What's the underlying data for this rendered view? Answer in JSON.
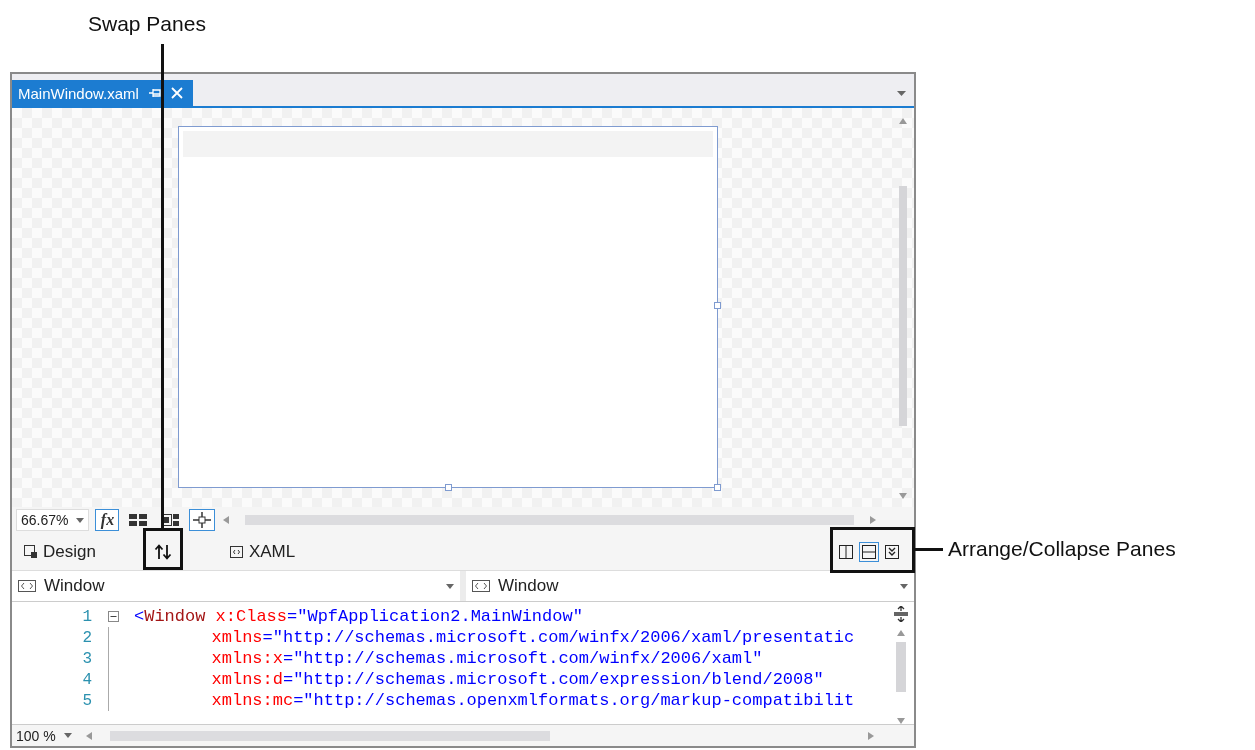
{
  "callouts": [
    {
      "label": "Swap Panes"
    },
    {
      "label": "Arrange/Collapse Panes"
    }
  ],
  "document_tab": {
    "title": "MainWindow.xaml"
  },
  "designer": {
    "zoom": "66.67%",
    "tools": [
      {
        "kind": "fx",
        "label": "fx",
        "on": true
      },
      {
        "kind": "grid",
        "on": false
      },
      {
        "kind": "snap-grid",
        "on": false
      },
      {
        "kind": "snap-points",
        "on": true
      }
    ]
  },
  "view_tabs": [
    {
      "kind": "design",
      "label": "Design"
    },
    {
      "kind": "swap"
    },
    {
      "kind": "xaml",
      "label": "XAML"
    }
  ],
  "pane_buttons": [
    {
      "kind": "vertical",
      "selected": false
    },
    {
      "kind": "horizontal",
      "selected": true
    },
    {
      "kind": "collapse",
      "selected": false
    }
  ],
  "element_selectors": [
    {
      "label": "Window"
    },
    {
      "label": "Window"
    }
  ],
  "code_lines": [
    {
      "number": "1",
      "fold_toggle": true,
      "indented": false,
      "segments": [
        {
          "kind": "punct",
          "text": "<"
        },
        {
          "kind": "element",
          "text": "Window"
        },
        {
          "kind": "attr",
          "text": "x:Class"
        },
        {
          "kind": "punct",
          "text": "="
        },
        {
          "kind": "value",
          "text": "\"WpfApplication2.MainWindow\""
        }
      ]
    },
    {
      "number": "2",
      "fold_toggle": false,
      "indented": true,
      "segments": [
        {
          "kind": "attr",
          "text": "xmlns"
        },
        {
          "kind": "punct",
          "text": "="
        },
        {
          "kind": "value",
          "text": "\"http://schemas.microsoft.com/winfx/2006/xaml/presentatic"
        }
      ]
    },
    {
      "number": "3",
      "fold_toggle": false,
      "indented": true,
      "segments": [
        {
          "kind": "attr",
          "text": "xmlns:x"
        },
        {
          "kind": "punct",
          "text": "="
        },
        {
          "kind": "value",
          "text": "\"http://schemas.microsoft.com/winfx/2006/xaml\""
        }
      ]
    },
    {
      "number": "4",
      "fold_toggle": false,
      "indented": true,
      "segments": [
        {
          "kind": "attr",
          "text": "xmlns:d"
        },
        {
          "kind": "punct",
          "text": "="
        },
        {
          "kind": "value",
          "text": "\"http://schemas.microsoft.com/expression/blend/2008\""
        }
      ]
    },
    {
      "number": "5",
      "fold_toggle": false,
      "indented": true,
      "segments": [
        {
          "kind": "attr",
          "text": "xmlns:mc"
        },
        {
          "kind": "punct",
          "text": "="
        },
        {
          "kind": "value",
          "text": "\"http://schemas.openxmlformats.org/markup-compatibilit"
        }
      ]
    }
  ],
  "code_zoom": "100 %"
}
